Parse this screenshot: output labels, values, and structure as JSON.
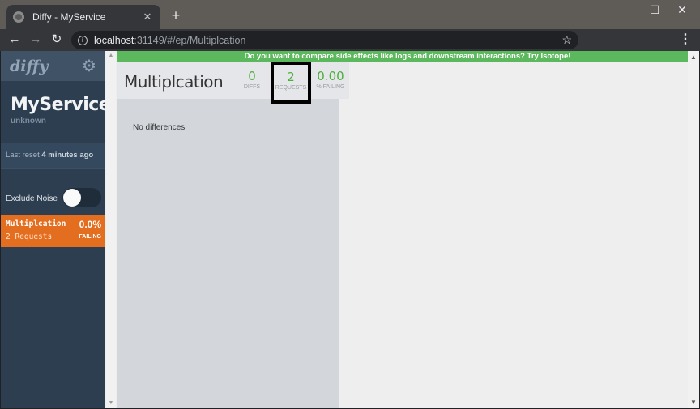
{
  "browser": {
    "tab_title": "Diffy - MyService",
    "url_host": "localhost",
    "url_rest": ":31149/#/ep/Multiplcation"
  },
  "sidebar": {
    "logo": "diffy",
    "service_name": "MyService",
    "service_env": "unknown",
    "reset_prefix": "Last reset",
    "reset_value": "4 minutes ago",
    "exclude_noise_label": "Exclude Noise",
    "exclude_noise_on": false,
    "endpoints": [
      {
        "name": "Multiplcation",
        "requests": "2 Requests",
        "pct": "0.0%",
        "failing_label": "FAILING"
      }
    ]
  },
  "main": {
    "banner": "Do you want to compare side effects like logs and downstream interactions? Try Isotope!",
    "endpoint_title": "Multiplcation",
    "stats": {
      "diffs_value": "0",
      "diffs_label": "DIFFS",
      "requests_value": "2",
      "requests_label": "REQUESTS",
      "failing_value": "0.00",
      "failing_label": "% FAILING"
    },
    "no_differences": "No differences"
  },
  "colors": {
    "sidebar_bg": "#2c3e50",
    "endpoint_active": "#e46e1f",
    "banner": "#5cb85c",
    "stat_number": "#4caf3a"
  }
}
